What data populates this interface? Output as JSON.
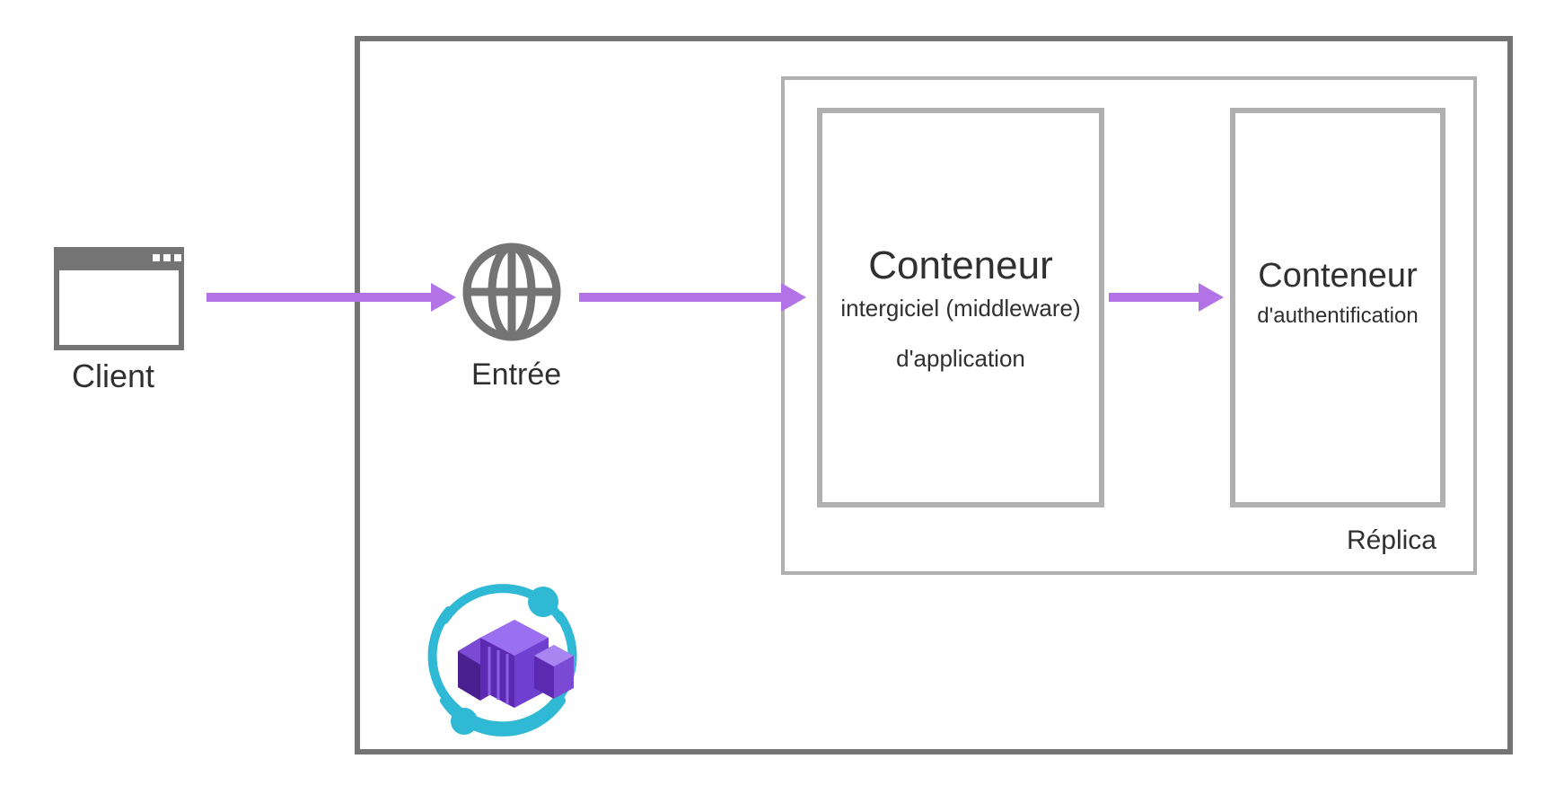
{
  "client": {
    "label": "Client"
  },
  "ingress": {
    "label": "Entrée"
  },
  "replica": {
    "label": "Réplica"
  },
  "container1": {
    "title": "Conteneur",
    "line1": "intergiciel (middleware)",
    "line2": "d'application"
  },
  "container2": {
    "title": "Conteneur",
    "line1": "d'authentification"
  },
  "colors": {
    "arrow": "#b173e6",
    "border_dark": "#747474",
    "border_light": "#b0b0b0",
    "azure_teal": "#2fb9d4",
    "azure_purple_dark": "#5b2ab0",
    "azure_purple_light": "#8d5ee8"
  }
}
